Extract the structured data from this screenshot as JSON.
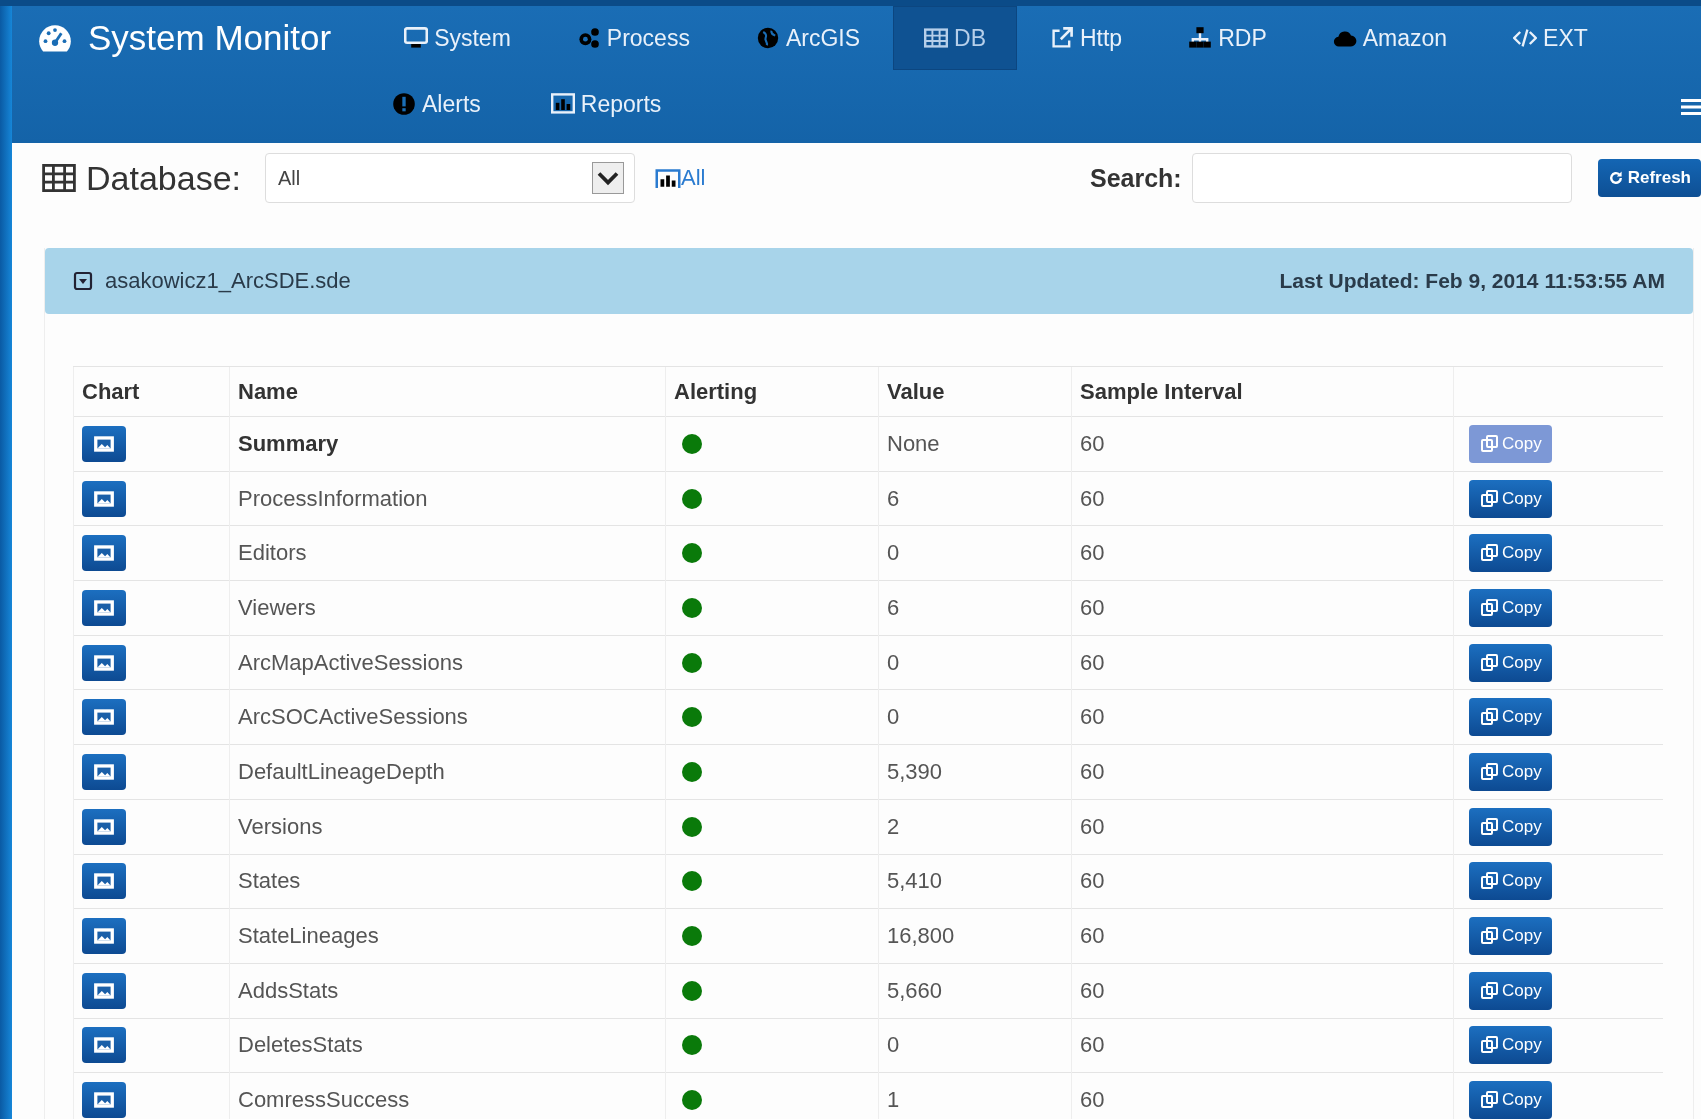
{
  "nav": {
    "brand": "System Monitor",
    "primary": [
      {
        "label": "System",
        "selected": false
      },
      {
        "label": "Process",
        "selected": false
      },
      {
        "label": "ArcGIS",
        "selected": false
      },
      {
        "label": "DB",
        "selected": true
      },
      {
        "label": "Http",
        "selected": false
      },
      {
        "label": "RDP",
        "selected": false
      },
      {
        "label": "Amazon",
        "selected": false
      },
      {
        "label": "EXT",
        "selected": false
      }
    ],
    "secondary": [
      {
        "label": "Alerts",
        "selected": false
      },
      {
        "label": "Reports",
        "selected": false
      }
    ]
  },
  "toolbar": {
    "database_label": "Database:",
    "database_select": {
      "value": "All"
    },
    "all_link": "All",
    "search_label": "Search:",
    "refresh_button": "Refresh"
  },
  "panel": {
    "title": "asakowicz1_ArcSDE.sde",
    "last_updated": "Last Updated: Feb 9, 2014 11:53:55 AM",
    "table": {
      "columns": [
        "Chart",
        "Name",
        "Alerting",
        "Value",
        "Sample Interval"
      ],
      "rows": [
        {
          "kind": "summary",
          "name": "Summary",
          "color": "#0a7a0a",
          "value": "None",
          "interval": "60",
          "copy": {
            "label": "Copy",
            "disabled": true
          }
        },
        {
          "kind": "metric",
          "name": "ProcessInformation",
          "color": "#0a7a0a",
          "value": "6",
          "interval": "60",
          "copy": {
            "label": "Copy",
            "disabled": false
          }
        },
        {
          "kind": "metric",
          "name": "Editors",
          "color": "#0a7a0a",
          "value": "0",
          "interval": "60",
          "copy": {
            "label": "Copy",
            "disabled": false
          }
        },
        {
          "kind": "metric",
          "name": "Viewers",
          "color": "#0a7a0a",
          "value": "6",
          "interval": "60",
          "copy": {
            "label": "Copy",
            "disabled": false
          }
        },
        {
          "kind": "metric",
          "name": "ArcMapActiveSessions",
          "color": "#0a7a0a",
          "value": "0",
          "interval": "60",
          "copy": {
            "label": "Copy",
            "disabled": false
          }
        },
        {
          "kind": "metric",
          "name": "ArcSOCActiveSessions",
          "color": "#0a7a0a",
          "value": "0",
          "interval": "60",
          "copy": {
            "label": "Copy",
            "disabled": false
          }
        },
        {
          "kind": "metric",
          "name": "DefaultLineageDepth",
          "color": "#0a7a0a",
          "value": "5,390",
          "interval": "60",
          "copy": {
            "label": "Copy",
            "disabled": false
          }
        },
        {
          "kind": "metric",
          "name": "Versions",
          "color": "#0a7a0a",
          "value": "2",
          "interval": "60",
          "copy": {
            "label": "Copy",
            "disabled": false
          }
        },
        {
          "kind": "metric",
          "name": "States",
          "color": "#0a7a0a",
          "value": "5,410",
          "interval": "60",
          "copy": {
            "label": "Copy",
            "disabled": false
          }
        },
        {
          "kind": "metric",
          "name": "StateLineages",
          "color": "#0a7a0a",
          "value": "16,800",
          "interval": "60",
          "copy": {
            "label": "Copy",
            "disabled": false
          }
        },
        {
          "kind": "metric",
          "name": "AddsStats",
          "color": "#0a7a0a",
          "value": "5,660",
          "interval": "60",
          "copy": {
            "label": "Copy",
            "disabled": false
          }
        },
        {
          "kind": "metric",
          "name": "DeletesStats",
          "color": "#0a7a0a",
          "value": "0",
          "interval": "60",
          "copy": {
            "label": "Copy",
            "disabled": false
          }
        },
        {
          "kind": "metric",
          "name": "ComressSuccess",
          "color": "#0a7a0a",
          "value": "1",
          "interval": "60",
          "copy": {
            "label": "Copy",
            "disabled": false
          }
        }
      ]
    }
  }
}
